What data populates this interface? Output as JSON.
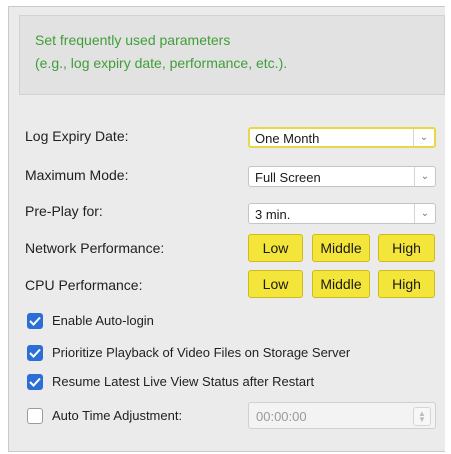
{
  "info": {
    "line1": "Set frequently used parameters",
    "line2": "(e.g., log expiry date, performance, etc.)."
  },
  "log_expiry": {
    "label": "Log Expiry Date:",
    "value": "One Month"
  },
  "maximum_mode": {
    "label": "Maximum Mode:",
    "value": "Full Screen"
  },
  "pre_play": {
    "label": "Pre-Play for:",
    "value": "3 min."
  },
  "network_performance": {
    "label": "Network Performance:",
    "options": [
      "Low",
      "Middle",
      "High"
    ]
  },
  "cpu_performance": {
    "label": "CPU Performance:",
    "options": [
      "Low",
      "Middle",
      "High"
    ]
  },
  "checkboxes": [
    {
      "label": "Enable Auto-login",
      "checked": true
    },
    {
      "label": "Prioritize Playback of Video Files on Storage Server",
      "checked": true
    },
    {
      "label": "Resume Latest Live View Status after Restart",
      "checked": true
    },
    {
      "label": "Auto Time Adjustment:",
      "checked": false
    }
  ],
  "auto_time": {
    "value": "00:00:00"
  },
  "colors": {
    "info_text": "#3f9e38",
    "button_yellow": "#f4e53a",
    "checkbox_blue": "#2a6fd6"
  }
}
